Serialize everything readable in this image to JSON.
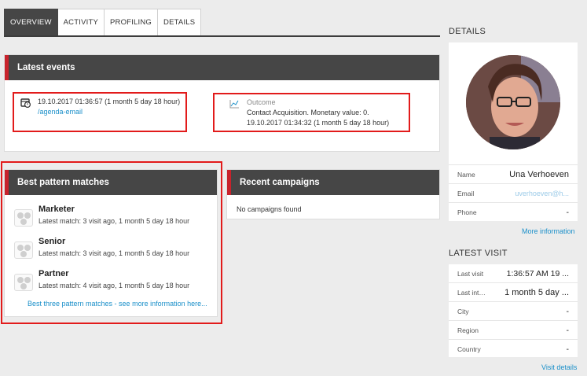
{
  "tabs": [
    "OVERVIEW",
    "ACTIVITY",
    "PROFILING",
    "DETAILS"
  ],
  "latest_events": {
    "title": "Latest events",
    "event1": {
      "time": "19.10.2017 01:36:57 (1 month 5 day 18 hour)",
      "link": "/agenda-email"
    },
    "event2": {
      "label": "Outcome",
      "text": "Contact Acquisition. Monetary value: 0.",
      "time": "19.10.2017 01:34:32 (1 month 5 day 18 hour)"
    }
  },
  "pattern_matches": {
    "title": "Best pattern matches",
    "items": [
      {
        "name": "Marketer",
        "detail": "Latest match: 3 visit ago, 1 month 5 day 18 hour"
      },
      {
        "name": "Senior",
        "detail": "Latest match: 3 visit ago, 1 month 5 day 18 hour"
      },
      {
        "name": "Partner",
        "detail": "Latest match: 4 visit ago, 1 month 5 day 18 hour"
      }
    ],
    "more_link": "Best three pattern matches - see more information here..."
  },
  "campaigns": {
    "title": "Recent campaigns",
    "empty": "No campaigns found"
  },
  "details": {
    "title": "DETAILS",
    "rows": [
      {
        "label": "Name",
        "value": "Una Verhoeven"
      },
      {
        "label": "Email",
        "value": "uverhoeven@h..."
      },
      {
        "label": "Phone",
        "value": "-"
      }
    ],
    "more_link": "More information"
  },
  "latest_visit": {
    "title": "LATEST VISIT",
    "rows": [
      {
        "label": "Last visit",
        "value": "1:36:57 AM 19 ..."
      },
      {
        "label": "Last interaction",
        "value": "1 month 5 day ..."
      },
      {
        "label": "City",
        "value": "-"
      },
      {
        "label": "Region",
        "value": "-"
      },
      {
        "label": "Country",
        "value": "-"
      }
    ],
    "link": "Visit details"
  },
  "colors": {
    "accent": "#c8232c",
    "link": "#1a8fc9",
    "header": "#464646",
    "highlight": "#e21b1b"
  }
}
